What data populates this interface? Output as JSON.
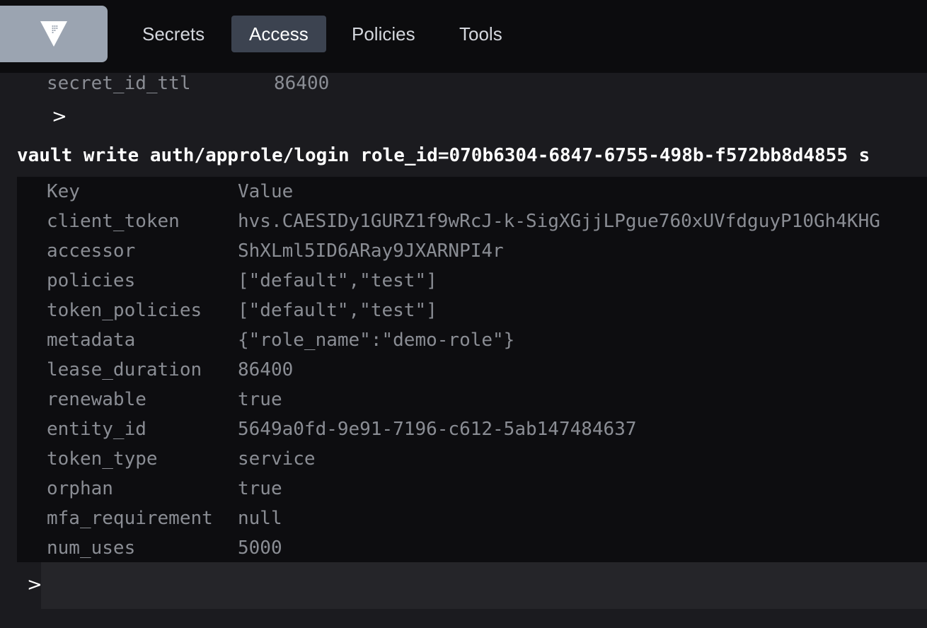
{
  "nav": {
    "logo_icon": "vault-triangle-logo",
    "items": [
      {
        "label": "Secrets",
        "active": false
      },
      {
        "label": "Access",
        "active": true
      },
      {
        "label": "Policies",
        "active": false
      },
      {
        "label": "Tools",
        "active": false
      }
    ]
  },
  "console": {
    "previous_output_last_row": {
      "key": "secret_id_ttl",
      "value": "86400"
    },
    "prompt_symbol": ">",
    "command": "vault write auth/approle/login role_id=070b6304-6847-6755-498b-f572bb8d4855 s",
    "output": {
      "header": {
        "key": "Key",
        "value": "Value"
      },
      "rows": [
        {
          "key": "client_token",
          "value": "hvs.CAESIDy1GURZ1f9wRcJ-k-SigXGjjLPgue760xUVfdguyP10Gh4KHG"
        },
        {
          "key": "accessor",
          "value": "ShXLml5ID6ARay9JXARNPI4r"
        },
        {
          "key": "policies",
          "value": "[\"default\",\"test\"]"
        },
        {
          "key": "token_policies",
          "value": "[\"default\",\"test\"]"
        },
        {
          "key": "metadata",
          "value": "{\"role_name\":\"demo-role\"}"
        },
        {
          "key": "lease_duration",
          "value": "86400"
        },
        {
          "key": "renewable",
          "value": "true"
        },
        {
          "key": "entity_id",
          "value": "5649a0fd-9e91-7196-c612-5ab147484637"
        },
        {
          "key": "token_type",
          "value": "service"
        },
        {
          "key": "orphan",
          "value": "true"
        },
        {
          "key": "mfa_requirement",
          "value": "null"
        },
        {
          "key": "num_uses",
          "value": "5000"
        }
      ]
    },
    "input_value": ""
  },
  "colors": {
    "topbar_bg": "#0c0c0e",
    "logo_bg": "#9ba4b1",
    "active_tab_bg": "#3c4350",
    "console_bg": "#1b1b1f",
    "output_bg": "#0d0d10",
    "muted_text": "#8a8d94"
  }
}
